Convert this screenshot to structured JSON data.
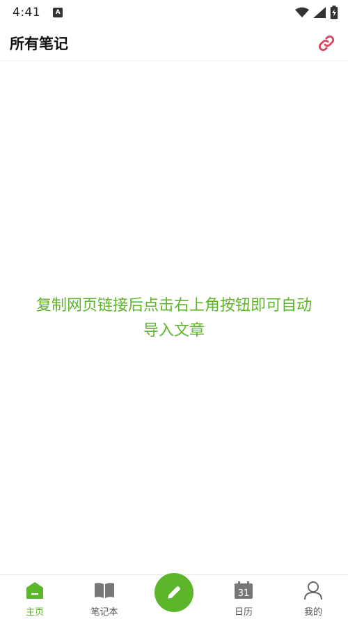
{
  "status_bar": {
    "time": "4:41",
    "app_icon_letter": "A",
    "icons": [
      "wifi-icon",
      "signal-icon",
      "battery-charging-icon"
    ]
  },
  "header": {
    "title": "所有笔记",
    "action_icon": "link-icon",
    "accent_color": "#d9455f"
  },
  "main": {
    "empty_hint_line1": "复制网页链接后点击右上角按钮即可自动",
    "empty_hint_line2": "导入文章",
    "hint_color": "#5cb52a"
  },
  "bottom_nav": {
    "items": [
      {
        "label": "主页",
        "icon": "home-icon",
        "active": true
      },
      {
        "label": "笔记本",
        "icon": "notebook-icon",
        "active": false
      },
      {
        "label": "",
        "icon": "pencil-icon",
        "active": false
      },
      {
        "label": "日历",
        "icon": "calendar-icon",
        "active": false,
        "icon_text": "31"
      },
      {
        "label": "我的",
        "icon": "profile-icon",
        "active": false
      }
    ],
    "fab_color": "#5cb52a"
  }
}
